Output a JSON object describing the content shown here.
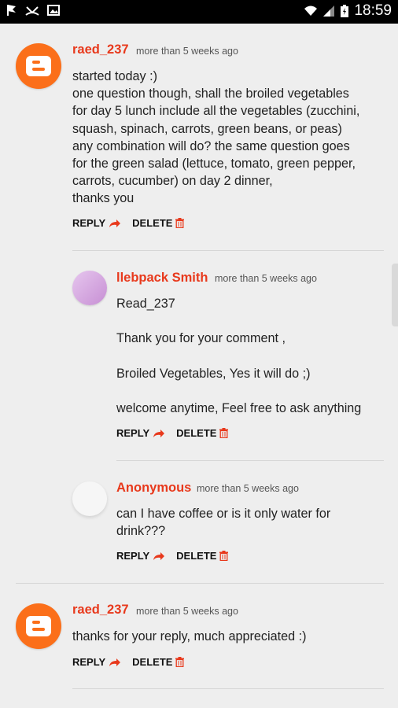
{
  "status_bar": {
    "time": "18:59"
  },
  "comments": [
    {
      "author": "raed_237",
      "time": "more than 5 weeks ago",
      "body": "started today :)\none question though, shall the broiled vegetables\nfor day 5 lunch include all the vegetables (zucchini,\nsquash, spinach, carrots, green beans, or peas)\nany combination will do? the same question goes\nfor the green salad (lettuce, tomato, green pepper,\ncarrots, cucumber) on day 2 dinner,\nthanks you",
      "reply_label": "REPLY",
      "delete_label": "DELETE"
    },
    {
      "author": "llebpack Smith",
      "time": "more than 5 weeks ago",
      "body": "Read_237\n\nThank you for your comment ,\n\nBroiled Vegetables, Yes it will do ;)\n\nwelcome anytime, Feel free to ask anything",
      "reply_label": "REPLY",
      "delete_label": "DELETE"
    },
    {
      "author": "Anonymous",
      "time": "more than 5 weeks ago",
      "body": "can I have coffee or is it only water for\ndrink???",
      "reply_label": "REPLY",
      "delete_label": "DELETE"
    },
    {
      "author": "raed_237",
      "time": "more than 5 weeks ago",
      "body": "thanks for your reply, much appreciated :)",
      "reply_label": "REPLY",
      "delete_label": "DELETE"
    }
  ],
  "colors": {
    "accent": "#e8391c",
    "blogger_orange": "#fb6f1a"
  }
}
